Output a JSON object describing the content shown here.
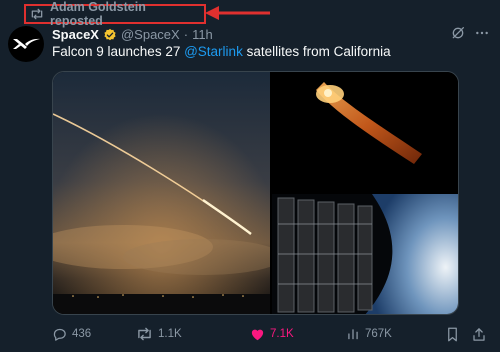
{
  "repost": {
    "text": "Adam Goldstein reposted",
    "annotation_color": "#e0302f"
  },
  "tweet": {
    "author_name": "SpaceX",
    "handle": "@SpaceX",
    "separator": "·",
    "time": "11h",
    "text_before": "Falcon 9 launches 27 ",
    "mention": "@Starlink",
    "text_after": " satellites from California",
    "verified_color": "#f4c430",
    "mention_color": "#1d9bf0"
  },
  "media": {
    "items": [
      "rocket-launch-night-sky-image",
      "rocket-plume-image",
      "starlink-satellites-over-earth-image"
    ]
  },
  "actions": {
    "replies": "436",
    "reposts": "1.1K",
    "likes": "7.1K",
    "views": "767K",
    "like_color": "#f91880"
  },
  "icons": {
    "repost": "repost-icon",
    "verified": "verified-badge-icon",
    "grok": "grok-icon",
    "more": "more-icon",
    "reply": "reply-icon",
    "like": "heart-icon",
    "views": "views-icon",
    "bookmark": "bookmark-icon",
    "share": "share-icon"
  }
}
